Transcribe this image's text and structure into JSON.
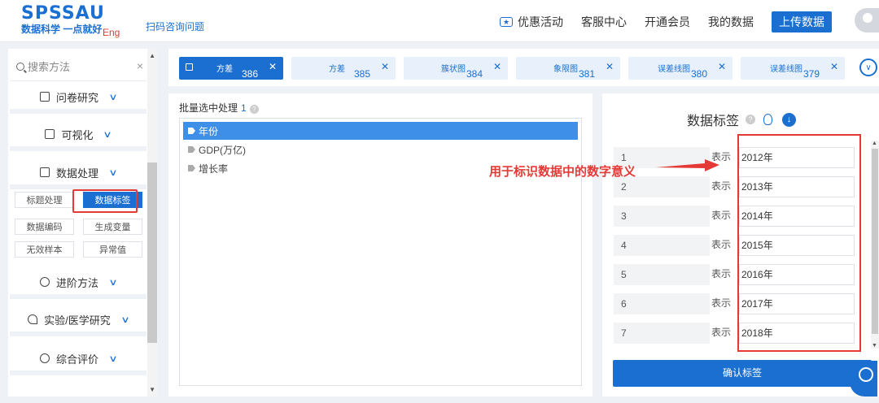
{
  "header": {
    "brand": "SPSSAU",
    "slogan": "数据科学 一点就好",
    "lang": "Eng",
    "scan_link": "扫码咨询问题",
    "nav": [
      "优惠活动",
      "客服中心",
      "开通会员",
      "我的数据"
    ],
    "upload": "上传数据"
  },
  "sidebar": {
    "search_placeholder": "搜索方法",
    "clear": "×",
    "groups": [
      {
        "label": "问卷研究",
        "icon": "document-icon"
      },
      {
        "label": "可视化",
        "icon": "chart-icon"
      },
      {
        "label": "数据处理",
        "icon": "database-icon"
      },
      {
        "label": "进阶方法",
        "icon": "paperclip-icon"
      },
      {
        "label": "实验/医学研究",
        "icon": "heart-icon"
      },
      {
        "label": "综合评价",
        "icon": "pie-icon"
      }
    ],
    "sub_items": [
      "标题处理",
      "数据标签",
      "数据编码",
      "生成变量",
      "无效样本",
      "异常值"
    ],
    "active_sub": "数据标签"
  },
  "tabs": [
    {
      "name": "方差",
      "num": "386"
    },
    {
      "name": "方差",
      "num": "385"
    },
    {
      "name": "簇状图",
      "num": "384"
    },
    {
      "name": "象限图",
      "num": "381"
    },
    {
      "name": "误差线图",
      "num": "380"
    },
    {
      "name": "误差线图",
      "num": "379"
    }
  ],
  "middle": {
    "title": "批量选中处理",
    "count": "1",
    "help": "?",
    "variables": [
      "年份",
      "GDP(万亿)",
      "增长率"
    ]
  },
  "right": {
    "title": "数据标签",
    "help": "?",
    "download": "↓",
    "rows": [
      {
        "idx": "1",
        "word": "表示",
        "value": "2012年"
      },
      {
        "idx": "2",
        "word": "表示",
        "value": "2013年"
      },
      {
        "idx": "3",
        "word": "表示",
        "value": "2014年"
      },
      {
        "idx": "4",
        "word": "表示",
        "value": "2015年"
      },
      {
        "idx": "5",
        "word": "表示",
        "value": "2016年"
      },
      {
        "idx": "6",
        "word": "表示",
        "value": "2017年"
      },
      {
        "idx": "7",
        "word": "表示",
        "value": "2018年"
      }
    ],
    "confirm": "确认标签"
  },
  "annotation": "用于标识数据中的数字意义",
  "colors": {
    "accent": "#1a6fd1",
    "highlight": "#e53935"
  }
}
